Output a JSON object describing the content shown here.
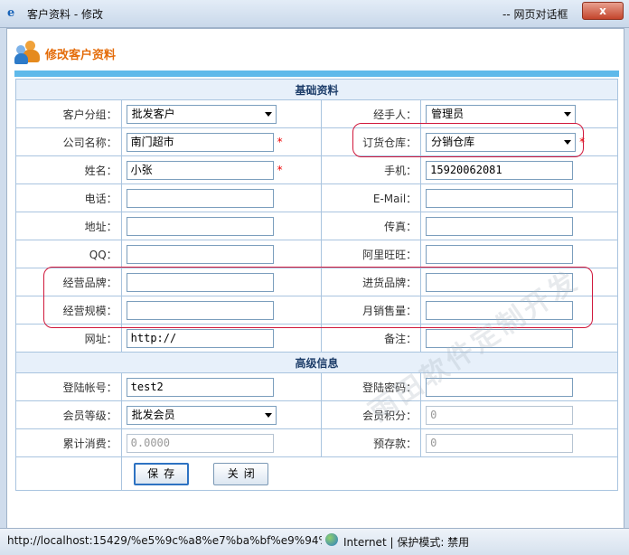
{
  "window": {
    "title": "客户资料 - 修改",
    "title_suffix": "-- 网页对话框",
    "close_label": "x"
  },
  "page": {
    "heading": "修改客户资料",
    "basic_section": "基础资料",
    "advanced_section": "高级信息"
  },
  "fields": {
    "customer_group": {
      "label": "客户分组：",
      "value": "批发客户"
    },
    "handler": {
      "label": "经手人：",
      "value": "管理员"
    },
    "company": {
      "label": "公司名称：",
      "value": "南门超市"
    },
    "warehouse": {
      "label": "订货仓库：",
      "value": "分销仓库"
    },
    "name": {
      "label": "姓名：",
      "value": "小张"
    },
    "mobile": {
      "label": "手机：",
      "value": "15920062081"
    },
    "phone": {
      "label": "电话：",
      "value": ""
    },
    "email": {
      "label": "E-Mail：",
      "value": ""
    },
    "address": {
      "label": "地址：",
      "value": ""
    },
    "fax": {
      "label": "传真：",
      "value": ""
    },
    "qq": {
      "label": "QQ：",
      "value": ""
    },
    "aliwangwang": {
      "label": "阿里旺旺：",
      "value": ""
    },
    "business_brand": {
      "label": "经营品牌：",
      "value": ""
    },
    "purchase_brand": {
      "label": "进货品牌：",
      "value": ""
    },
    "business_scale": {
      "label": "经营规模：",
      "value": ""
    },
    "monthly_sales": {
      "label": "月销售量：",
      "value": ""
    },
    "website": {
      "label": "网址：",
      "value": "http://"
    },
    "remark": {
      "label": "备注：",
      "value": ""
    },
    "login_account": {
      "label": "登陆帐号：",
      "value": "test2"
    },
    "login_password": {
      "label": "登陆密码：",
      "value": ""
    },
    "member_level": {
      "label": "会员等级：",
      "value": "批发会员"
    },
    "member_points": {
      "label": "会员积分：",
      "value": "0"
    },
    "total_spent": {
      "label": "累计消费：",
      "value": "0.0000"
    },
    "prepaid": {
      "label": "预存款：",
      "value": "0"
    }
  },
  "required_mark": "*",
  "buttons": {
    "save": "保存",
    "close": "关闭"
  },
  "watermark": "雨田软件定制开发",
  "statusbar": {
    "url": "http://localhost:15429/%e5%9c%a8%e7%ba%bf%e9%94%8",
    "zone": "Internet | 保护模式: 禁用"
  },
  "colors": {
    "heading": "#e46c0a",
    "accent_bar": "#5fb9ea",
    "highlight": "#d0173b",
    "required": "#ee0000"
  }
}
